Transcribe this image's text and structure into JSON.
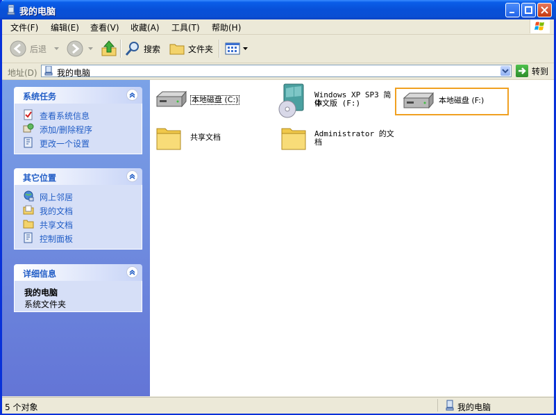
{
  "window": {
    "title": "我的电脑"
  },
  "menu": [
    "文件(F)",
    "编辑(E)",
    "查看(V)",
    "收藏(A)",
    "工具(T)",
    "帮助(H)"
  ],
  "toolbar": {
    "back": "后退",
    "search": "搜索",
    "folders": "文件夹"
  },
  "address": {
    "label": "地址(D)",
    "value": "我的电脑",
    "go": "转到"
  },
  "panels": {
    "tasks": {
      "title": "系统任务",
      "items": [
        "查看系统信息",
        "添加/删除程序",
        "更改一个设置"
      ]
    },
    "places": {
      "title": "其它位置",
      "items": [
        "网上邻居",
        "我的文档",
        "共享文档",
        "控制面板"
      ]
    },
    "details": {
      "title": "详细信息",
      "name": "我的电脑",
      "desc": "系统文件夹"
    }
  },
  "items": {
    "drive_c": "本地磁盘 (C:)",
    "cd_line1": "Windows XP SP3 简体",
    "cd_line2": "中文版 (F:)",
    "drive_f": "本地磁盘 (F:)",
    "shared": "共享文档",
    "admin_line1": "Administrator 的文",
    "admin_line2": "档"
  },
  "status": {
    "count": "5 个对象",
    "location": "我的电脑"
  },
  "colors": {
    "accent": "#215dc6",
    "highlight": "#f0a020",
    "titlebar": "#0a5ee9"
  }
}
